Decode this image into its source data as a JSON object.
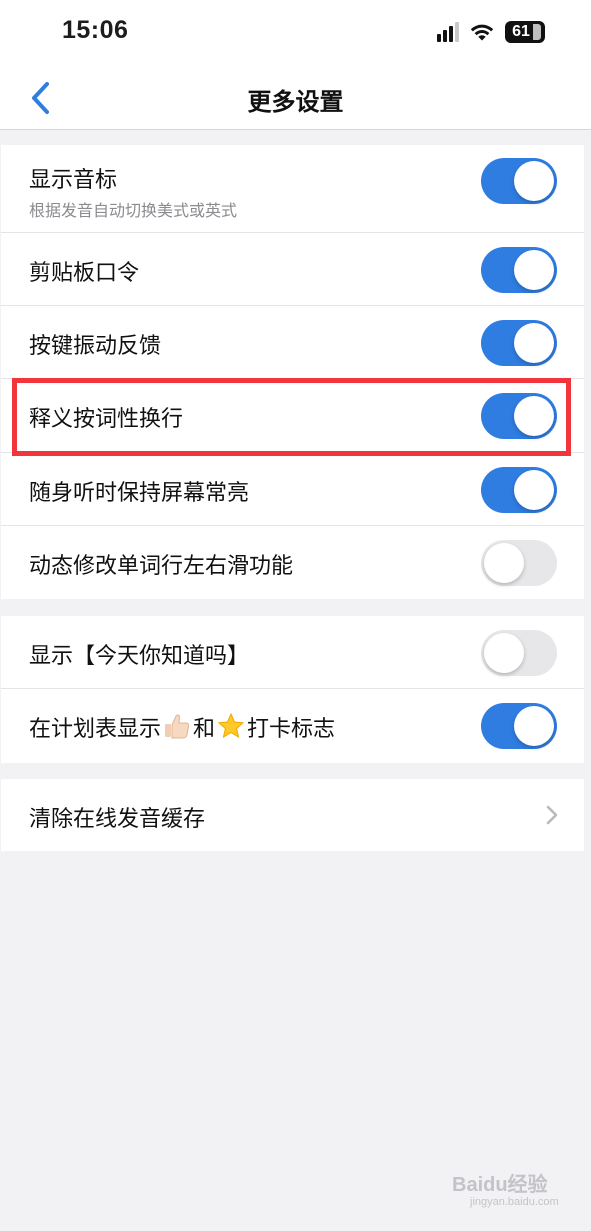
{
  "status_bar": {
    "time": "15:06",
    "battery_level": "61",
    "icons": [
      "signal-icon",
      "wifi-icon",
      "battery-icon"
    ]
  },
  "nav": {
    "title": "更多设置",
    "back_icon": "chevron-left-icon"
  },
  "colors": {
    "accent": "#2f7de1",
    "toggle_off": "#e7e7ea",
    "highlight": "#f0353c",
    "background": "#f2f2f4"
  },
  "settings": {
    "group1": [
      {
        "label": "显示音标",
        "sublabel": "根据发音自动切换美式或英式",
        "enabled": true
      },
      {
        "label": "剪贴板口令",
        "enabled": true
      },
      {
        "label": "按键振动反馈",
        "enabled": true
      },
      {
        "label": "释义按词性换行",
        "enabled": true,
        "highlighted": true
      },
      {
        "label": "随身听时保持屏幕常亮",
        "enabled": true
      },
      {
        "label": "动态修改单词行左右滑功能",
        "enabled": false
      }
    ],
    "group2": [
      {
        "label": "显示【今天你知道吗】",
        "enabled": false
      },
      {
        "label_before": "在计划表显示",
        "label_middle": "和",
        "label_after": "打卡标志",
        "icons": [
          "thumbs-up-icon",
          "star-icon"
        ],
        "enabled": true
      }
    ],
    "group3": [
      {
        "label": "清除在线发音缓存",
        "icon": "chevron-right-icon"
      }
    ]
  },
  "watermark": {
    "text": "Baidu经验",
    "sub": "jingyan.baidu.com"
  }
}
